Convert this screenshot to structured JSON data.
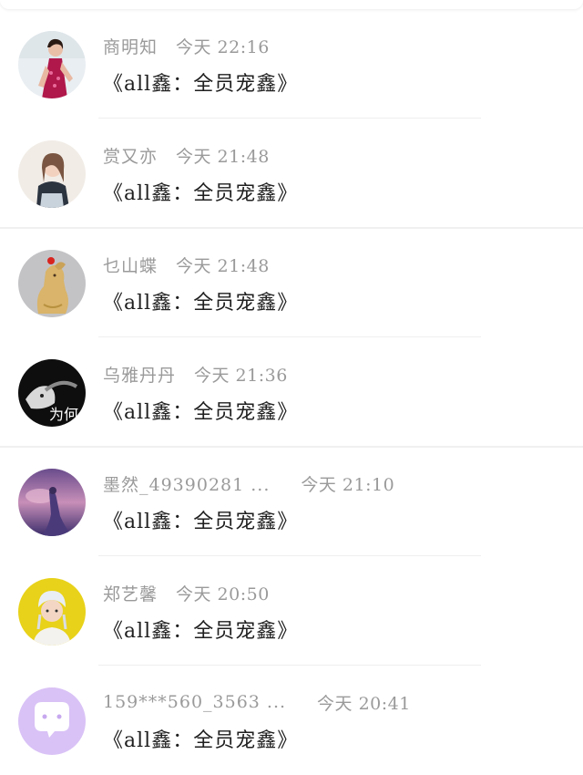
{
  "feed": {
    "items": [
      {
        "user": "商明知",
        "time": "今天 22:16",
        "title": "《all鑫：全员宠鑫》",
        "avatar": "woman-red-qipao-avatar"
      },
      {
        "user": "赏又亦",
        "time": "今天 21:48",
        "title": "《all鑫：全员宠鑫》",
        "avatar": "girl-portrait-avatar"
      },
      {
        "user": "乜山蝶",
        "time": "今天 21:48",
        "title": "《all鑫：全员宠鑫》",
        "avatar": "golden-dog-figurine-avatar"
      },
      {
        "user": "乌雅丹丹",
        "time": "今天 21:36",
        "title": "《all鑫：全员宠鑫》",
        "avatar": "dark-portrait-avatar",
        "avatar_text": "为何"
      },
      {
        "user": "墨然_49390281 ...",
        "time": "今天 21:10",
        "title": "《all鑫：全员宠鑫》",
        "avatar": "purple-sky-silhouette-avatar"
      },
      {
        "user": "郑艺馨",
        "time": "今天 20:50",
        "title": "《all鑫：全员宠鑫》",
        "avatar": "boy-white-hat-avatar"
      },
      {
        "user": "159***560_3563 ...",
        "time": "今天 20:41",
        "title": "《all鑫：全员宠鑫》",
        "avatar": "chat-bubble-default-avatar"
      }
    ]
  }
}
